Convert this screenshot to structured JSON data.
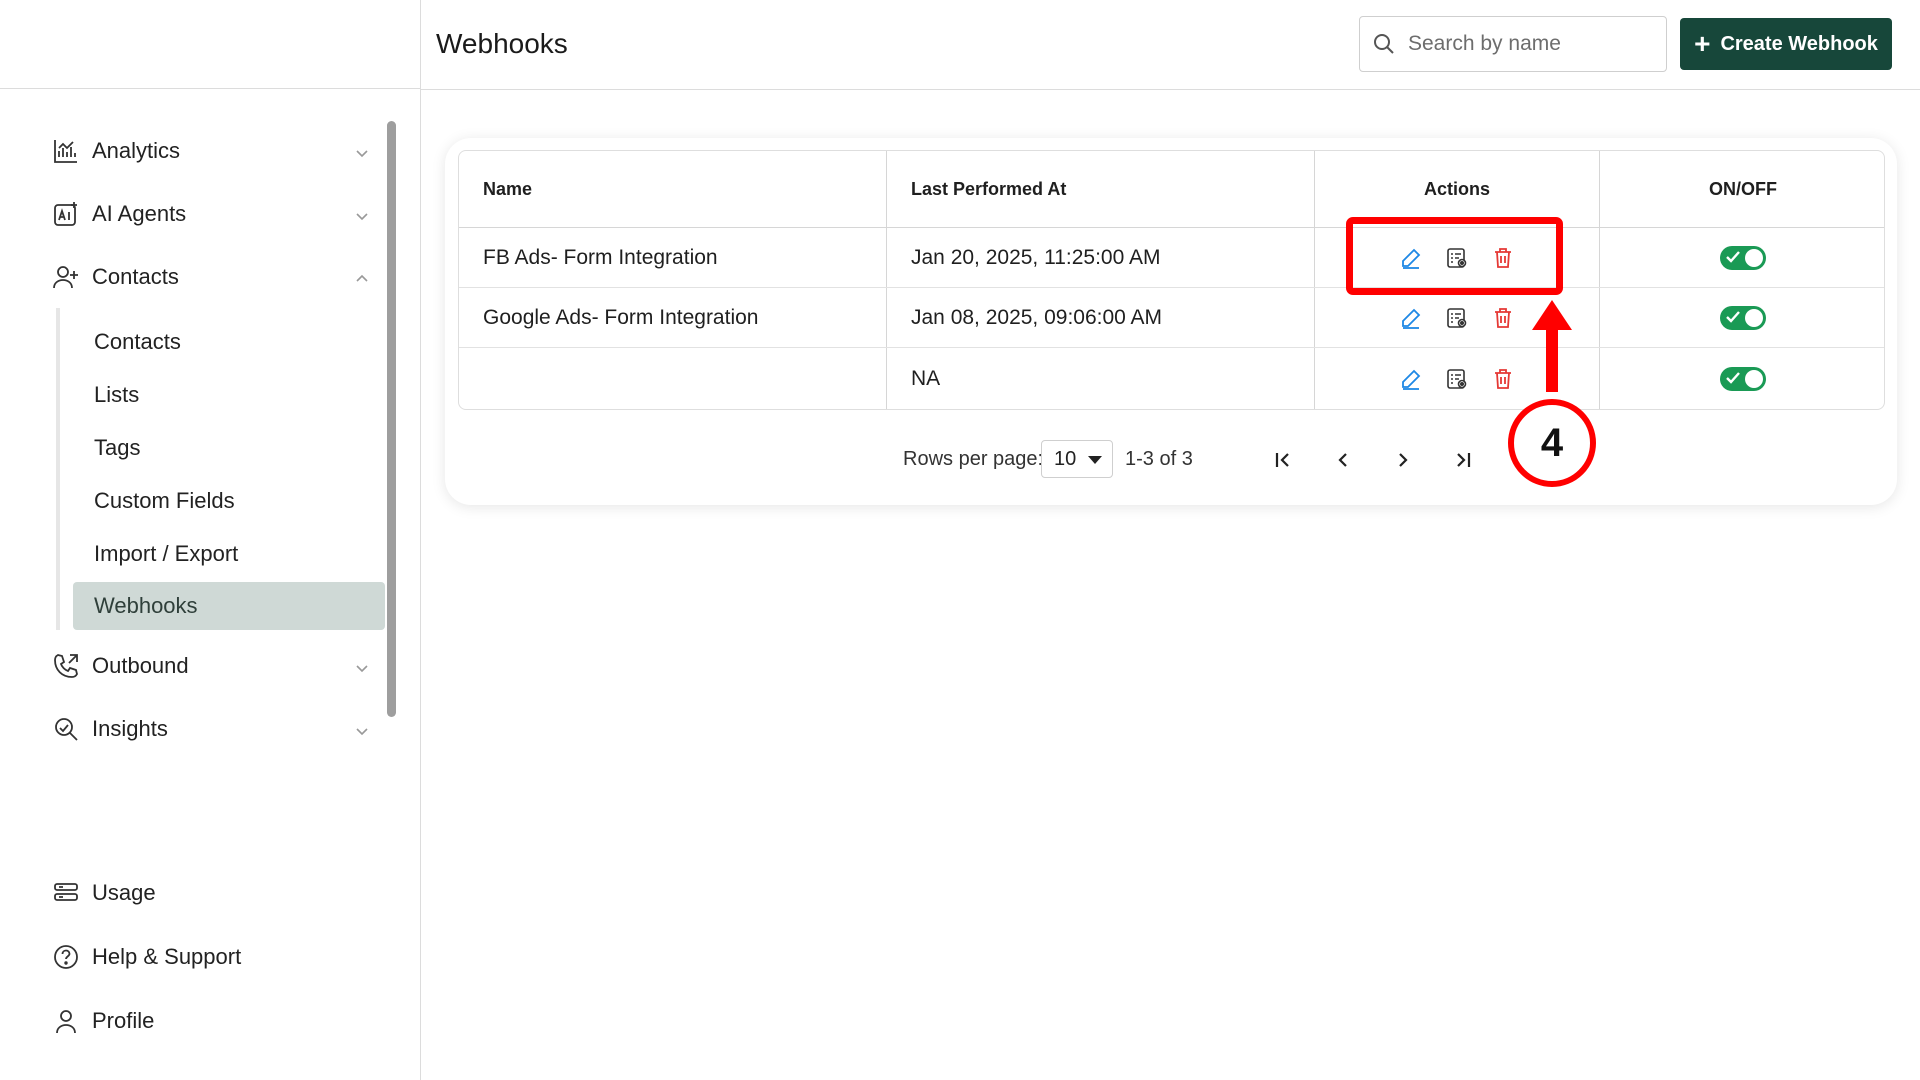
{
  "header": {
    "title": "Webhooks",
    "search_placeholder": "Search by name",
    "create_label": "Create Webhook"
  },
  "sidebar": {
    "items": [
      {
        "label": "Analytics",
        "icon": "analytics-icon"
      },
      {
        "label": "AI Agents",
        "icon": "ai-agents-icon"
      },
      {
        "label": "Contacts",
        "icon": "contacts-icon"
      },
      {
        "label": "Outbound",
        "icon": "outbound-icon"
      },
      {
        "label": "Insights",
        "icon": "insights-icon"
      }
    ],
    "sub_items": [
      "Contacts",
      "Lists",
      "Tags",
      "Custom Fields",
      "Import / Export",
      "Webhooks"
    ],
    "active_sub_item": "Webhooks",
    "bottom_items": [
      {
        "label": "Usage",
        "icon": "usage-icon"
      },
      {
        "label": "Help & Support",
        "icon": "help-icon"
      },
      {
        "label": "Profile",
        "icon": "profile-icon"
      }
    ]
  },
  "table": {
    "columns": [
      "Name",
      "Last Performed At",
      "Actions",
      "ON/OFF"
    ],
    "rows": [
      {
        "name": "FB Ads- Form Integration",
        "last_performed": "Jan 20, 2025, 11:25:00 AM",
        "enabled": true
      },
      {
        "name": "Google Ads- Form Integration",
        "last_performed": "Jan 08, 2025, 09:06:00 AM",
        "enabled": true
      },
      {
        "name": "",
        "last_performed": "NA",
        "enabled": true
      }
    ]
  },
  "pagination": {
    "rows_per_page_label": "Rows per page:",
    "rows_per_page": "10",
    "range": "1-3 of 3"
  },
  "annotation": {
    "step_number": "4"
  },
  "colors": {
    "brand": "#17473a",
    "active_nav": "#cfd9d6",
    "toggle_on": "#1a9a55",
    "edit_icon": "#1e88e5",
    "delete_icon": "#e53935",
    "annotation": "#ff0000"
  }
}
